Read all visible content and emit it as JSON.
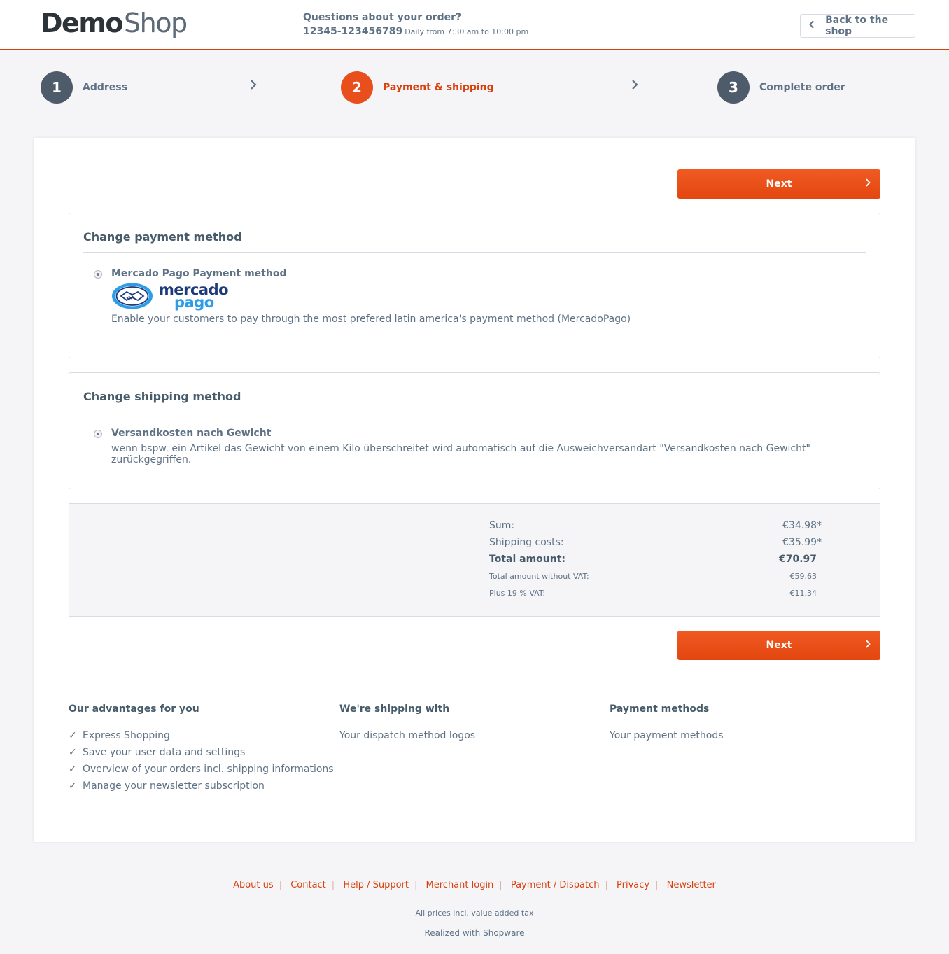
{
  "header": {
    "logo_demo": "Demo",
    "logo_shop": "Shop",
    "support_question": "Questions about your order?",
    "support_phone": "12345-123456789",
    "support_hours": "Daily from 7:30 am to 10:00 pm",
    "back_label": "Back to the shop"
  },
  "steps": [
    {
      "num": "1",
      "label": "Address"
    },
    {
      "num": "2",
      "label": "Payment & shipping"
    },
    {
      "num": "3",
      "label": "Complete order"
    }
  ],
  "next_label": "Next",
  "payment": {
    "title": "Change payment method",
    "method_name": "Mercado Pago Payment method",
    "logo_text_1": "mercado",
    "logo_text_2": "pago",
    "description": "Enable your customers to pay through the most prefered latin america's payment method (MercadoPago)"
  },
  "shipping": {
    "title": "Change shipping method",
    "method_name": "Versandkosten nach Gewicht",
    "description": "wenn bspw. ein Artikel das Gewicht von einem Kilo überschreitet wird automatisch auf die Ausweichversandart \"Versandkosten nach Gewicht\" zurückgegriffen."
  },
  "summary": {
    "sum_label": "Sum:",
    "sum_value": "€34.98*",
    "shipping_label": "Shipping costs:",
    "shipping_value": "€35.99*",
    "total_label": "Total amount:",
    "total_value": "€70.97",
    "net_label": "Total amount without VAT:",
    "net_value": "€59.63",
    "vat_label": "Plus 19 % VAT:",
    "vat_value": "€11.34"
  },
  "footer_cols": {
    "advantages_title": "Our advantages for you",
    "advantages": [
      "Express Shopping",
      "Save your user data and settings",
      "Overview of your orders incl. shipping informations",
      "Manage your newsletter subscription"
    ],
    "shipping_title": "We're shipping with",
    "shipping_text": "Your dispatch method logos",
    "payment_title": "Payment methods",
    "payment_text": "Your payment methods"
  },
  "footer_links": [
    "About us",
    "Contact",
    "Help / Support",
    "Merchant login",
    "Payment / Dispatch",
    "Privacy",
    "Newsletter"
  ],
  "vat_note": "All prices incl. value added tax",
  "realized": "Realized with Shopware",
  "colors": {
    "accent": "#d9400b",
    "step_active": "#e84f1c",
    "step_inactive": "#4e5b6a"
  }
}
